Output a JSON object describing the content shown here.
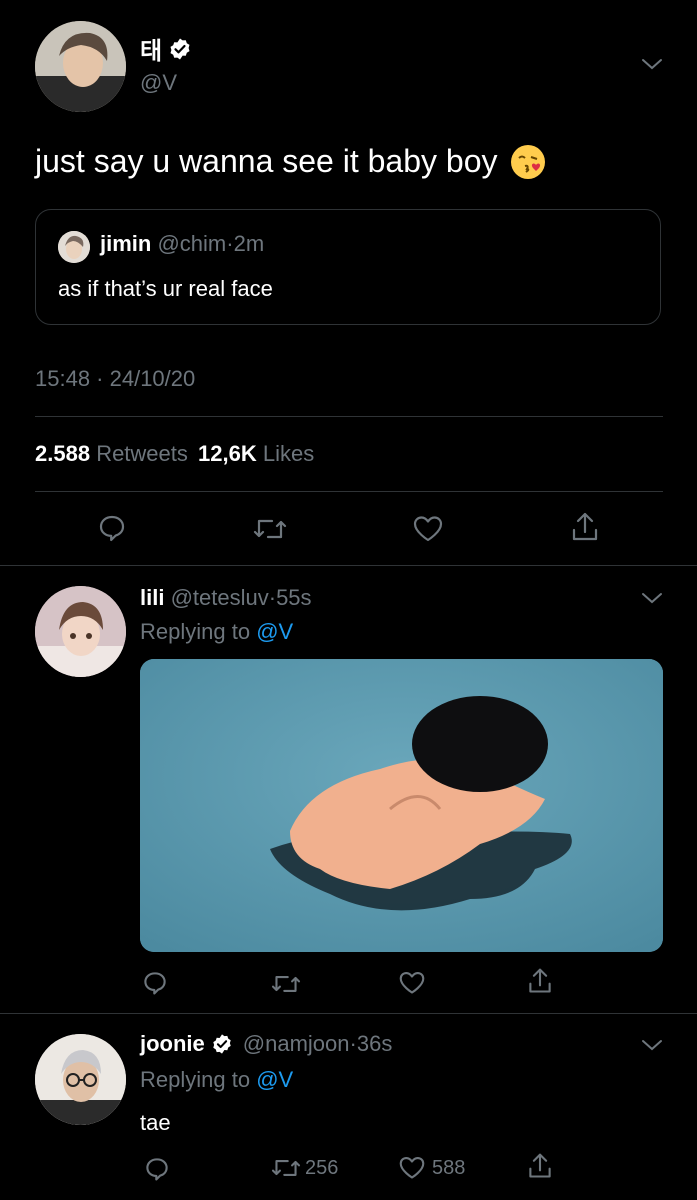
{
  "main_tweet": {
    "display_name": "태",
    "handle": "@V",
    "text": "just say u wanna see it baby boy",
    "emoji": "😘",
    "quoted": {
      "name": "jimin",
      "handle": "@chim",
      "dot": "·",
      "time": "2m",
      "text": "as if that’s ur real face"
    },
    "timestamp": "15:48 · 24/10/20",
    "retweets_count": "2.588",
    "retweets_label": "Retweets",
    "likes_count": "12,6K",
    "likes_label": "Likes"
  },
  "replies": [
    {
      "name": "lili",
      "handle": "@tetesluv",
      "dot": "·",
      "time": "55s",
      "replying_to_label": "Replying to",
      "replying_to": "@V"
    },
    {
      "name": "joonie",
      "handle": "@namjoon",
      "dot": "·",
      "time": "36s",
      "replying_to_label": "Replying to",
      "replying_to": "@V",
      "text": "tae",
      "retweet_count": "256",
      "like_count": "588"
    }
  ],
  "colors": {
    "background": "#000000",
    "muted": "#6e767d",
    "accent": "#1d9bf0",
    "divider": "#2f3336"
  }
}
